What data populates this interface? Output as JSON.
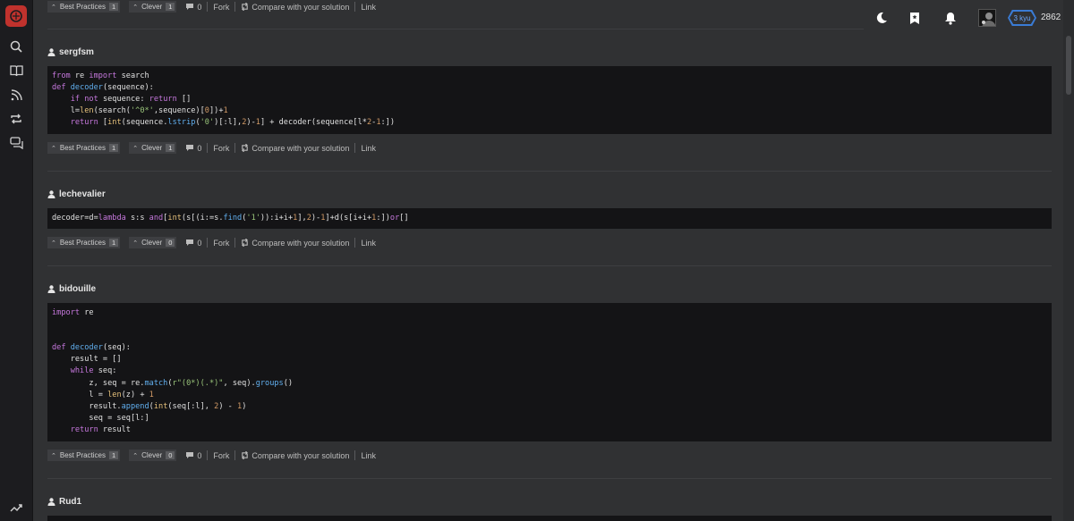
{
  "sidebar": {
    "logo": "codewars-logo",
    "items": [
      "search-icon",
      "book-icon",
      "rss-icon",
      "repeat-icon",
      "chat-icon"
    ],
    "bottom": "trend-icon"
  },
  "topbar": {
    "rank": "3 kyu",
    "honor": "2862"
  },
  "actions_labels": {
    "best_practices": "Best Practices",
    "clever": "Clever",
    "fork": "Fork",
    "compare": "Compare with your solution",
    "link": "Link"
  },
  "solutions": [
    {
      "author": "",
      "best_practices": "1",
      "clever": "1",
      "comments": "0"
    },
    {
      "author": "sergfsm",
      "best_practices": "1",
      "clever": "1",
      "comments": "0"
    },
    {
      "author": "lechevalier",
      "best_practices": "1",
      "clever": "0",
      "comments": "0"
    },
    {
      "author": "bidouille",
      "best_practices": "1",
      "clever": "0",
      "comments": "0"
    },
    {
      "author": "Rud1"
    }
  ],
  "code": {
    "sergfsm": [
      "from re import search",
      "def decoder(sequence):",
      "    if not sequence: return []",
      "    l=len(search('^0*',sequence)[0])+1",
      "    return [int(sequence.lstrip('0')[:l],2)-1] + decoder(sequence[l*2-1:])"
    ],
    "lechevalier": [
      "decoder=d=lambda s:s and[int(s[(i:=s.find('1')):i+i+1],2)-1]+d(s[i+i+1:])or[]"
    ],
    "bidouille": [
      "import re",
      "",
      "",
      "def decoder(seq):",
      "    result = []",
      "    while seq:",
      "        z, seq = re.match(r\"(0*)(.*)\", seq).groups()",
      "        l = len(z) + 1",
      "        result.append(int(seq[:l], 2) - 1)",
      "        seq = seq[l:]",
      "    return result"
    ]
  }
}
